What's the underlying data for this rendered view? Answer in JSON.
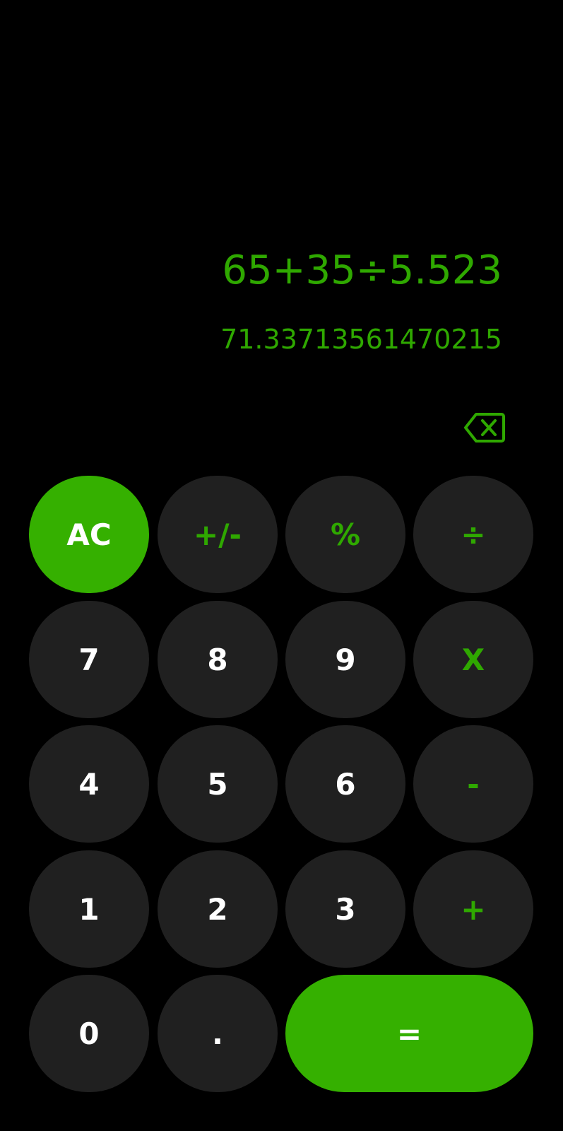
{
  "display": {
    "expression": "65+35÷5.523",
    "result": "71.33713561470215"
  },
  "backspace_icon": "backspace-icon",
  "colors": {
    "accent": "#35b000",
    "accent_text": "#2fa800",
    "key_bg": "#202020",
    "background": "#000000"
  },
  "keys": {
    "clear": "AC",
    "sign": "+/-",
    "percent": "%",
    "divide": "÷",
    "seven": "7",
    "eight": "8",
    "nine": "9",
    "multiply": "X",
    "four": "4",
    "five": "5",
    "six": "6",
    "minus": "-",
    "one": "1",
    "two": "2",
    "three": "3",
    "plus": "+",
    "zero": "0",
    "dot": ".",
    "equals": "="
  }
}
